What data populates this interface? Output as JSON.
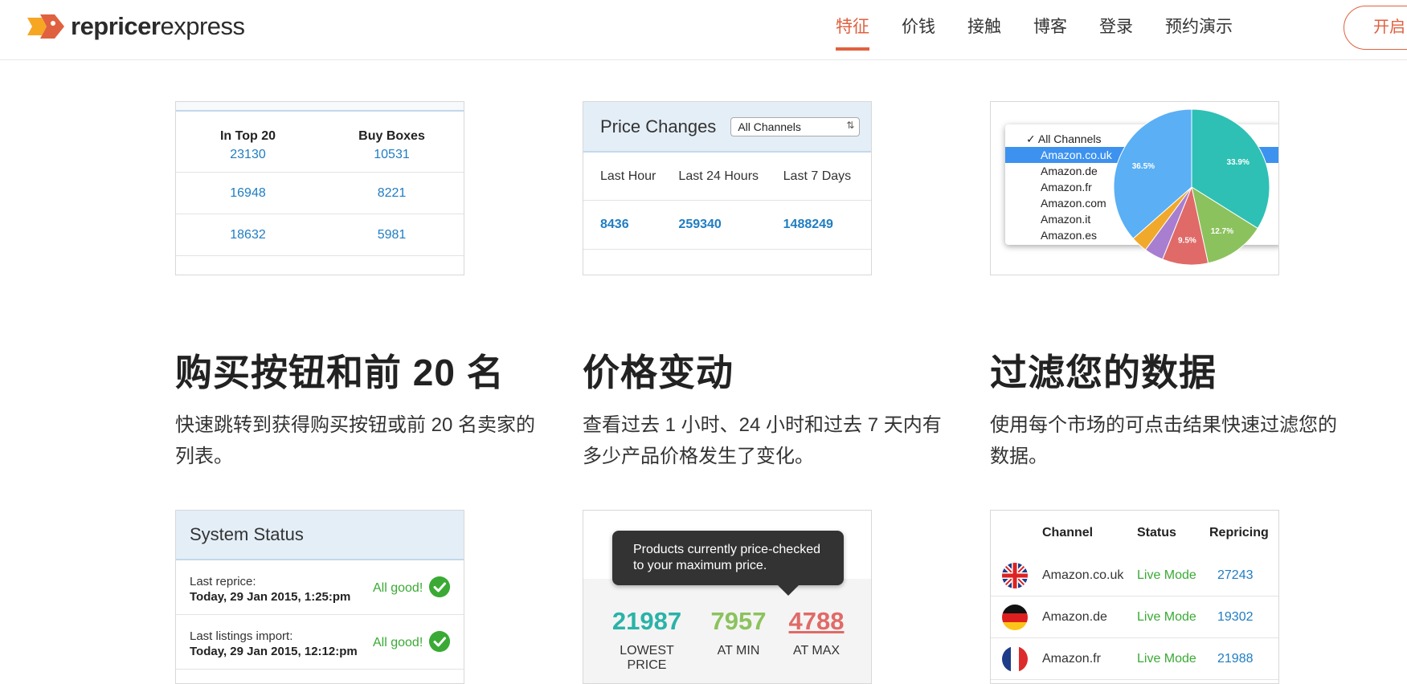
{
  "header": {
    "logo_bold": "repricer",
    "logo_light": "express",
    "nav": [
      {
        "label": "特征",
        "active": true
      },
      {
        "label": "价钱"
      },
      {
        "label": "接触"
      },
      {
        "label": "博客"
      },
      {
        "label": "登录"
      },
      {
        "label": "预约演示"
      }
    ],
    "cta_label": "开启"
  },
  "card_top20": {
    "col1": "In Top 20",
    "col2": "Buy Boxes",
    "rows": [
      [
        "23130",
        "10531"
      ],
      [
        "16948",
        "8221"
      ],
      [
        "18632",
        "5981"
      ]
    ]
  },
  "card_price_changes": {
    "title": "Price Changes",
    "select_value": "All Channels",
    "cols": [
      "Last Hour",
      "Last 24 Hours",
      "Last 7 Days"
    ],
    "values": [
      "8436",
      "259340",
      "1488249"
    ]
  },
  "card_filter": {
    "channels": [
      "All Channels",
      "Amazon.co.uk",
      "Amazon.de",
      "Amazon.fr",
      "Amazon.com",
      "Amazon.it",
      "Amazon.es"
    ],
    "selected": "Amazon.co.uk",
    "chart_data": {
      "type": "pie",
      "values": [
        33.9,
        12.7,
        9.5,
        4.0,
        3.4,
        36.5
      ],
      "labels": [
        "33.9%",
        "12.7%",
        "9.5%",
        "",
        "",
        "36.5%"
      ],
      "colors": [
        "#2ec0b4",
        "#8cc25d",
        "#e06a67",
        "#a77ed0",
        "#f1a92c",
        "#5aaff5"
      ]
    }
  },
  "features": [
    {
      "title": "购买按钮和前 20 名",
      "desc": "快速跳转到获得购买按钮或前 20 名卖家的列表。"
    },
    {
      "title": "价格变动",
      "desc": "查看过去 1 小时、24 小时和过去 7 天内有多少产品价格发生了变化。"
    },
    {
      "title": "过滤您的数据",
      "desc": "使用每个市场的可点击结果快速过滤您的数据。"
    }
  ],
  "card_status": {
    "title": "System Status",
    "rows": [
      {
        "label": "Last reprice:",
        "value": "Today, 29 Jan 2015, 1:25:pm",
        "ok": "All good!"
      },
      {
        "label": "Last listings import:",
        "value": "Today, 29 Jan 2015, 12:12:pm",
        "ok": "All good!"
      }
    ]
  },
  "card_price_check": {
    "tooltip": "Products currently price-checked to your maximum price.",
    "stats": [
      {
        "value": "21987",
        "label": "LOWEST PRICE",
        "color": "#2ab3a8"
      },
      {
        "value": "7957",
        "label": "AT MIN",
        "color": "#8cc25d"
      },
      {
        "value": "4788",
        "label": "AT MAX",
        "color": "#e06a67"
      }
    ]
  },
  "card_channels": {
    "cols": [
      "Channel",
      "Status",
      "Repricing"
    ],
    "rows": [
      {
        "flag": "uk-flag-icon",
        "channel": "Amazon.co.uk",
        "status": "Live Mode",
        "count": "27243"
      },
      {
        "flag": "de-flag-icon",
        "channel": "Amazon.de",
        "status": "Live Mode",
        "count": "19302"
      },
      {
        "flag": "fr-flag-icon",
        "channel": "Amazon.fr",
        "status": "Live Mode",
        "count": "21988"
      }
    ]
  },
  "colors": {
    "accent": "#e0613f",
    "link_blue": "#1f7dc2",
    "ok_green": "#3aaa35"
  }
}
